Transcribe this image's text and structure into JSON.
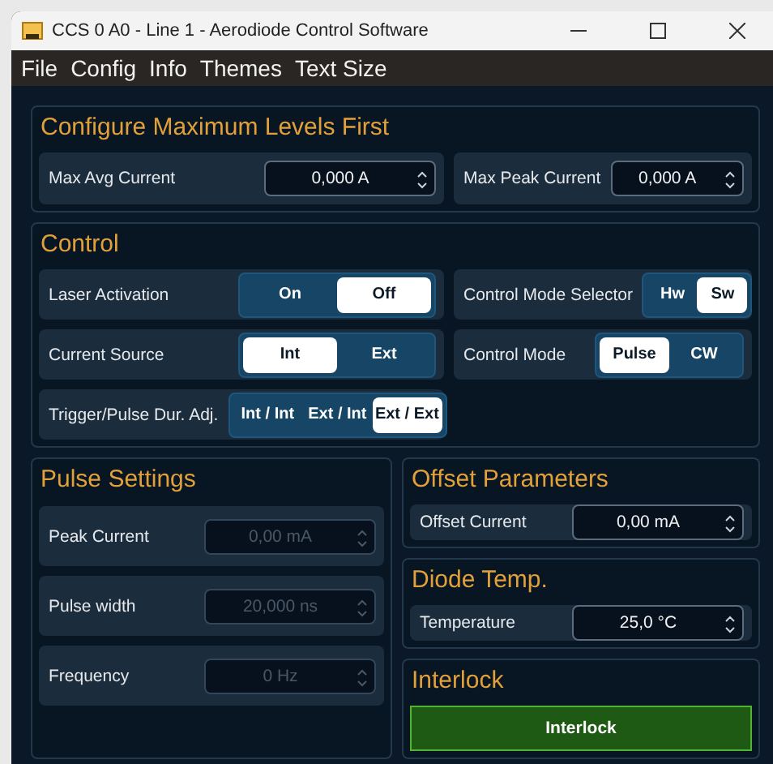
{
  "window": {
    "title": "CCS 0 A0 - Line 1 - Aerodiode Control Software"
  },
  "menu": [
    "File",
    "Config",
    "Info",
    "Themes",
    "Text Size"
  ],
  "max_levels": {
    "title": "Configure Maximum Levels First",
    "fields": [
      {
        "label": "Max Avg Current",
        "value": "0,000 A",
        "disabled": false
      },
      {
        "label": "Max Peak Current",
        "value": "0,000 A",
        "disabled": false
      }
    ]
  },
  "control": {
    "title": "Control",
    "rows": [
      {
        "label": "Laser Activation",
        "options": [
          {
            "label": "On",
            "selected": false
          },
          {
            "label": "Off",
            "selected": true
          }
        ]
      },
      {
        "label": "Control Mode Selector",
        "options": [
          {
            "label": "Hw",
            "selected": false
          },
          {
            "label": "Sw",
            "selected": true
          }
        ]
      },
      {
        "label": "Current Source",
        "options": [
          {
            "label": "Int",
            "selected": true
          },
          {
            "label": "Ext",
            "selected": false
          }
        ]
      },
      {
        "label": "Control Mode",
        "options": [
          {
            "label": "Pulse",
            "selected": true
          },
          {
            "label": "CW",
            "selected": false
          }
        ]
      },
      {
        "label": "Trigger/Pulse Dur. Adj.",
        "options": [
          {
            "label": "Int / Int",
            "selected": false
          },
          {
            "label": "Ext / Int",
            "selected": false
          },
          {
            "label": "Ext / Ext",
            "selected": true
          }
        ]
      }
    ]
  },
  "pulse_settings": {
    "title": "Pulse Settings",
    "fields": [
      {
        "label": "Peak Current",
        "value": "0,00 mA",
        "disabled": true
      },
      {
        "label": "Pulse width",
        "value": "20,000 ns",
        "disabled": true
      },
      {
        "label": "Frequency",
        "value": "0 Hz",
        "disabled": true
      }
    ]
  },
  "offset_parameters": {
    "title": "Offset Parameters",
    "fields": [
      {
        "label": "Offset Current",
        "value": "0,00 mA",
        "disabled": false
      }
    ]
  },
  "diode_temp": {
    "title": "Diode Temp.",
    "fields": [
      {
        "label": "Temperature",
        "value": "25,0 °C",
        "disabled": false
      }
    ]
  },
  "interlock": {
    "title": "Interlock",
    "indicator": {
      "label": "Interlock",
      "on": true
    }
  }
}
